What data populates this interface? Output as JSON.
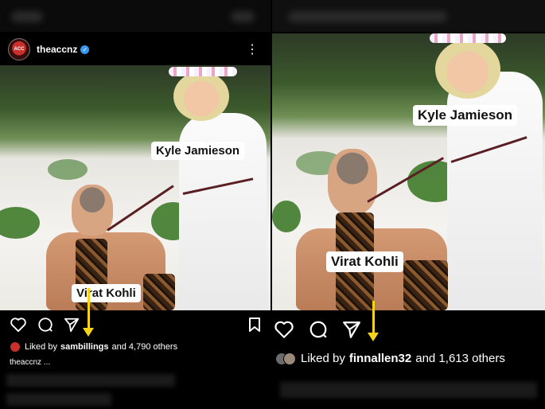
{
  "left_post": {
    "avatar_text": "ACC",
    "username": "theaccnz",
    "verified_glyph": "✓",
    "more_icon": "more-vertical-icon",
    "more_glyph": "⋮",
    "labels": {
      "top": "Kyle Jamieson",
      "bottom": "Virat Kohli"
    },
    "liked_by_prefix": "Liked by",
    "liked_by_user": "sambillings",
    "liked_by_suffix": "and 4,790 others",
    "caption": "theaccnz ..."
  },
  "right_post": {
    "labels": {
      "top": "Kyle Jamieson",
      "bottom": "Virat Kohli"
    },
    "liked_by_prefix": "Liked by",
    "liked_by_user": "finnallen32",
    "liked_by_suffix": "and 1,613 others"
  },
  "colors": {
    "arrow": "#f7d31a",
    "verified": "#3897f0",
    "leash": "#5a1f24"
  },
  "icons": [
    "heart-icon",
    "comment-icon",
    "share-icon",
    "bookmark-icon"
  ]
}
